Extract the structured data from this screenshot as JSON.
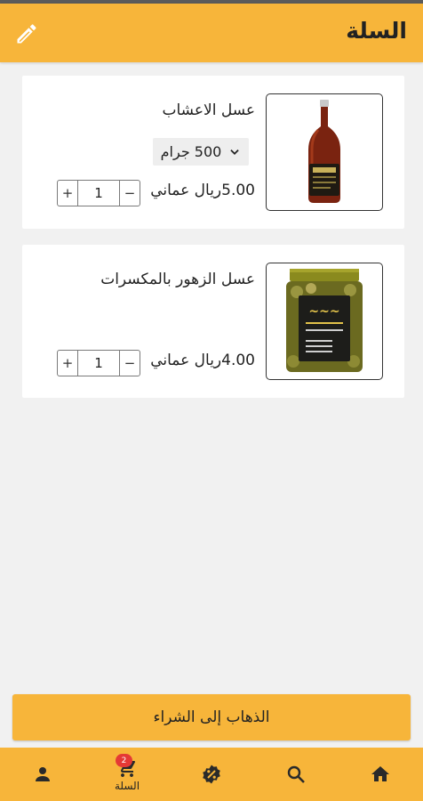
{
  "header": {
    "title": "السلة",
    "edit_icon": "pencil-icon"
  },
  "cart": {
    "items": [
      {
        "name": "عسل الاعشاب",
        "size": "500 جرام",
        "price": "5.00ريال عماني",
        "quantity": "1",
        "image": "honey-bottle"
      },
      {
        "name": "عسل الزهور بالمكسرات",
        "price": "4.00ريال عماني",
        "quantity": "1",
        "image": "honey-nuts-jar"
      }
    ]
  },
  "stepper": {
    "minus": "−",
    "plus": "+"
  },
  "checkout": {
    "label": "الذهاب إلى الشراء"
  },
  "bottom_nav": {
    "items": [
      {
        "icon": "home-icon"
      },
      {
        "icon": "search-icon"
      },
      {
        "icon": "badge-percent-icon"
      },
      {
        "icon": "cart-icon",
        "label": "السلة",
        "badge": "2"
      },
      {
        "icon": "person-icon"
      }
    ]
  },
  "colors": {
    "accent": "#f7b53a",
    "background": "#f1f1f1",
    "badge": "#e53935"
  }
}
